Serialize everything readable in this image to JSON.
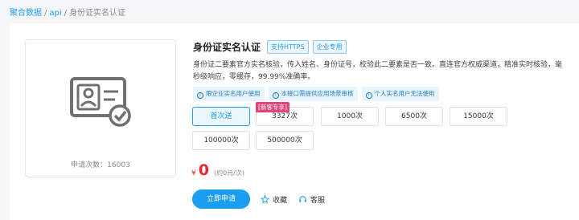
{
  "breadcrumb": {
    "home": "聚合数据",
    "section": "api",
    "current": "身份证实名认证",
    "separator": "/"
  },
  "product": {
    "title": "身份证实名认证",
    "tags": [
      "支持HTTPS",
      "企业专用"
    ],
    "description": "身份证二要素官方实名核验，传入姓名、身份证号，校验此二要素是否一致。直连官方权威渠道，精准实时核验，毫秒级响应，零缓存，99.99%准确率。",
    "notes": [
      "限企业实名用户使用",
      "本接口需提供应用场景审核",
      "个人实名用户无法使用"
    ],
    "request_count": "申请次数：16003"
  },
  "packages": {
    "badge": "新客专享",
    "items": [
      "首次送",
      "3327次",
      "1000次",
      "6500次",
      "15000次",
      "100000次",
      "500000次"
    ],
    "selected_index": 0
  },
  "price": {
    "currency": "¥",
    "amount": "0",
    "unit": "(约0元/次)"
  },
  "actions": {
    "apply": "立即申请",
    "favorite": "收藏",
    "service": "客服"
  },
  "colors": {
    "accent": "#1b9df0",
    "price": "#e9262c",
    "badge": "#e0447b"
  },
  "icons": {
    "product": "id-card-verified-icon",
    "note": "info-icon",
    "favorite": "star-icon",
    "service": "headset-icon"
  }
}
